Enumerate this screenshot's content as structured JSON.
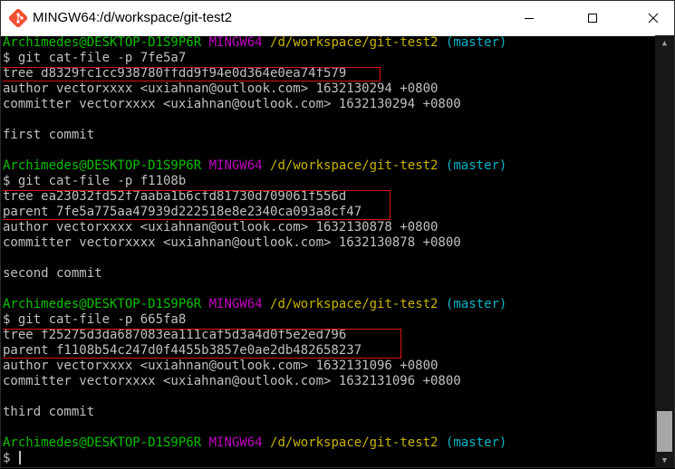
{
  "window": {
    "title": "MINGW64:/d/workspace/git-test2"
  },
  "prompt": {
    "user_host": "Archimedes@DESKTOP-D1S9P6R",
    "env": "MINGW64",
    "path": "/d/workspace/git-test2",
    "branch": "(master)",
    "symbol": "$"
  },
  "blocks": [
    {
      "command": "$ git cat-file -p 7fe5a7",
      "tree": "tree d8329fc1cc938780ffdd9f94e0d364e0ea74f579",
      "author": "author vectorxxxx <uxiahnan@outlook.com> 1632130294 +0800",
      "committer": "committer vectorxxxx <uxiahnan@outlook.com> 1632130294 +0800",
      "message": "first commit"
    },
    {
      "command": "$ git cat-file -p f1108b",
      "tree": "tree ea23032fd52f7aaba1b6cfd81730d709061f556d",
      "parent": "parent 7fe5a775aa47939d222518e8e2340ca093a8cf47",
      "author": "author vectorxxxx <uxiahnan@outlook.com> 1632130878 +0800",
      "committer": "committer vectorxxxx <uxiahnan@outlook.com> 1632130878 +0800",
      "message": "second commit"
    },
    {
      "command": "$ git cat-file -p 665fa8",
      "tree": "tree f25275d3da687083ea111caf5d3a4d0f5e2ed796",
      "parent": "parent f1108b54c247d0f4455b3857e0ae2db482658237",
      "author": "author vectorxxxx <uxiahnan@outlook.com> 1632131096 +0800",
      "committer": "committer vectorxxxx <uxiahnan@outlook.com> 1632131096 +0800",
      "message": "third commit"
    }
  ],
  "colors": {
    "background": "#000000",
    "text": "#c0c0c0",
    "user_host": "#0bbf00",
    "env": "#c000c0",
    "path": "#c8b400",
    "branch": "#00b4c8",
    "highlight_box": "#e01010"
  },
  "icons": {
    "app": "git-bash-icon",
    "minimize": "minimize-icon",
    "maximize": "maximize-icon",
    "close": "close-icon",
    "scroll_up": "scroll-up-icon",
    "scroll_down": "scroll-down-icon"
  }
}
